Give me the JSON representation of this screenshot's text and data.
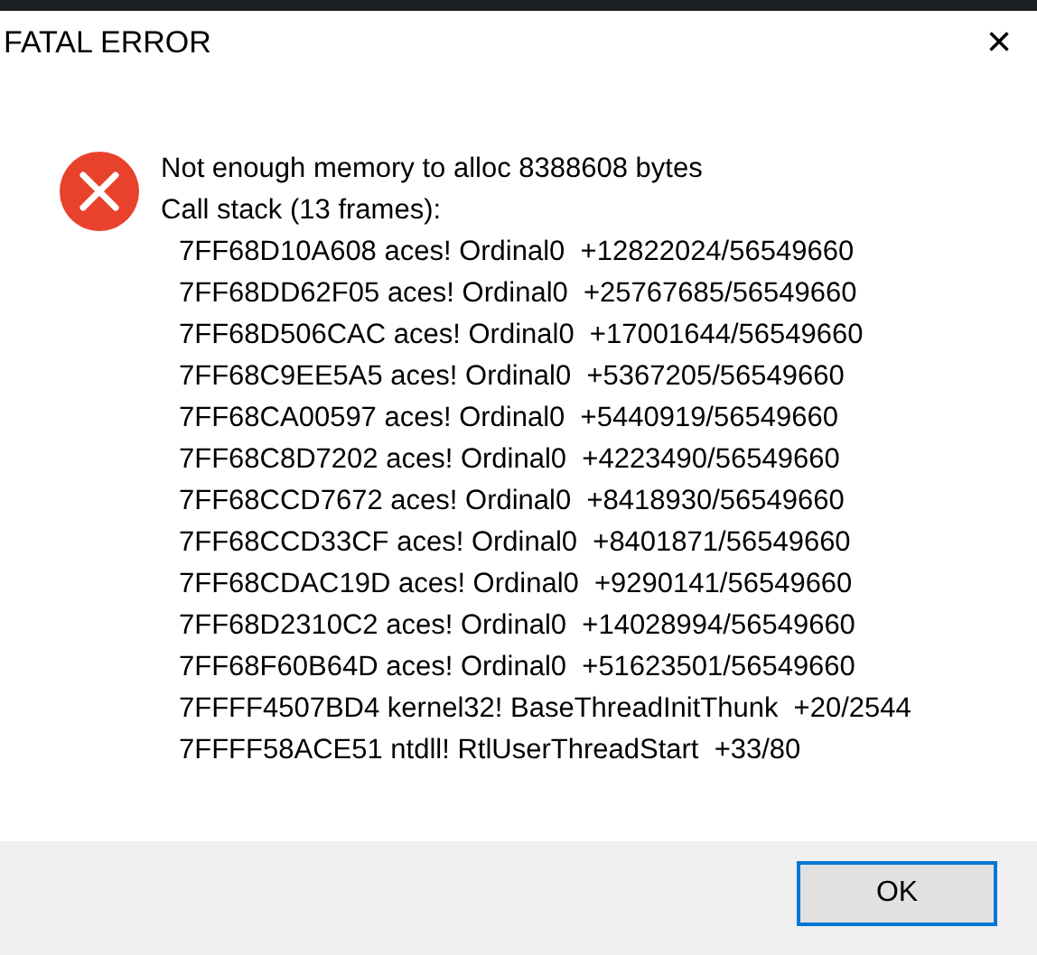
{
  "window": {
    "title": "FATAL ERROR",
    "close": "×"
  },
  "message": "Not enough memory to alloc 8388608 bytes",
  "stack_header": "Call stack (13 frames):",
  "frames": [
    "7FF68D10A608 aces! Ordinal0  +12822024/56549660",
    "7FF68DD62F05 aces! Ordinal0  +25767685/56549660",
    "7FF68D506CAC aces! Ordinal0  +17001644/56549660",
    "7FF68C9EE5A5 aces! Ordinal0  +5367205/56549660",
    "7FF68CA00597 aces! Ordinal0  +5440919/56549660",
    "7FF68C8D7202 aces! Ordinal0  +4223490/56549660",
    "7FF68CCD7672 aces! Ordinal0  +8418930/56549660",
    "7FF68CCD33CF aces! Ordinal0  +8401871/56549660",
    "7FF68CDAC19D aces! Ordinal0  +9290141/56549660",
    "7FF68D2310C2 aces! Ordinal0  +14028994/56549660",
    "7FF68F60B64D aces! Ordinal0  +51623501/56549660",
    "7FFFF4507BD4 kernel32! BaseThreadInitThunk  +20/2544",
    "7FFFF58ACE51 ntdll! RtlUserThreadStart  +33/80"
  ],
  "buttons": [
    {
      "label": "OK",
      "selected": true
    }
  ]
}
